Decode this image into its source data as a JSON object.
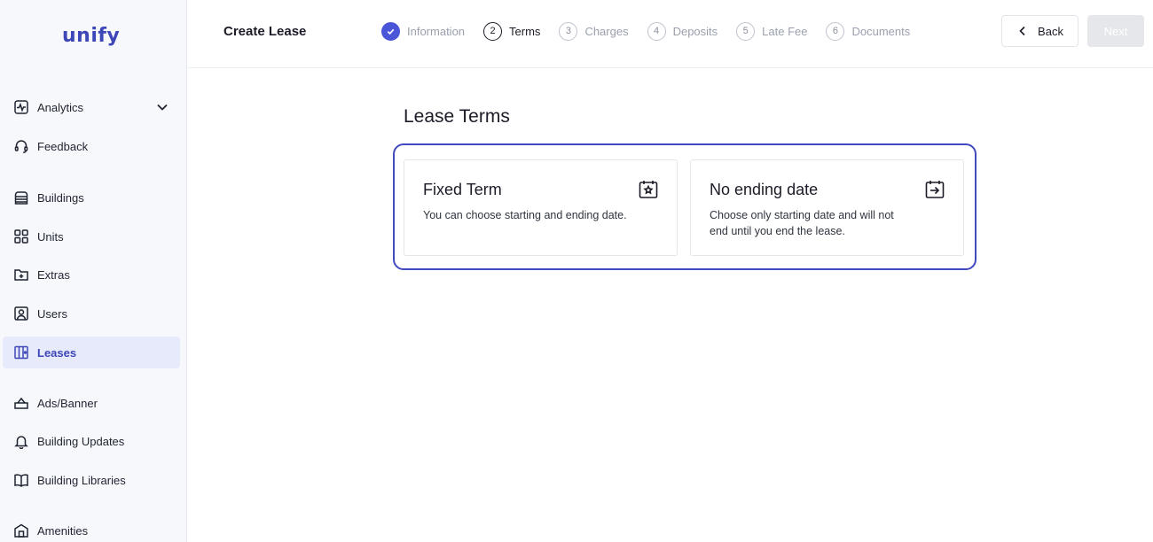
{
  "brand": {
    "logo": "unify"
  },
  "sidebar": {
    "items": [
      {
        "label": "Analytics",
        "icon": "activity-icon"
      },
      {
        "label": "Feedback",
        "icon": "headset-icon"
      },
      {
        "label": "Buildings",
        "icon": "building-icon"
      },
      {
        "label": "Units",
        "icon": "grid-icon"
      },
      {
        "label": "Extras",
        "icon": "folder-plus-icon"
      },
      {
        "label": "Users",
        "icon": "user-square-icon"
      },
      {
        "label": "Leases",
        "icon": "lease-icon",
        "active": true
      },
      {
        "label": "Ads/Banner",
        "icon": "basket-icon"
      },
      {
        "label": "Building Updates",
        "icon": "bell-icon"
      },
      {
        "label": "Building Libraries",
        "icon": "book-icon"
      },
      {
        "label": "Amenities",
        "icon": "amenities-icon"
      }
    ]
  },
  "header": {
    "title": "Create Lease",
    "steps": [
      {
        "num": "",
        "label": "Information",
        "state": "done"
      },
      {
        "num": "2",
        "label": "Terms",
        "state": "current"
      },
      {
        "num": "3",
        "label": "Charges",
        "state": "upcoming"
      },
      {
        "num": "4",
        "label": "Deposits",
        "state": "upcoming"
      },
      {
        "num": "5",
        "label": "Late Fee",
        "state": "upcoming"
      },
      {
        "num": "6",
        "label": "Documents",
        "state": "upcoming"
      }
    ],
    "back_label": "Back",
    "next_label": "Next"
  },
  "main": {
    "title": "Lease Terms",
    "options": [
      {
        "title": "Fixed Term",
        "desc": "You can choose starting and ending date.",
        "icon": "calendar-star-icon"
      },
      {
        "title": "No ending date",
        "desc": "Choose only starting date and will not end until you end the lease.",
        "icon": "calendar-arrow-icon"
      }
    ]
  },
  "colors": {
    "accent": "#3e47b8",
    "selection_border": "#4049c0",
    "active_nav_bg": "#e7eafb",
    "disabled_button": "#e6e7eb"
  }
}
